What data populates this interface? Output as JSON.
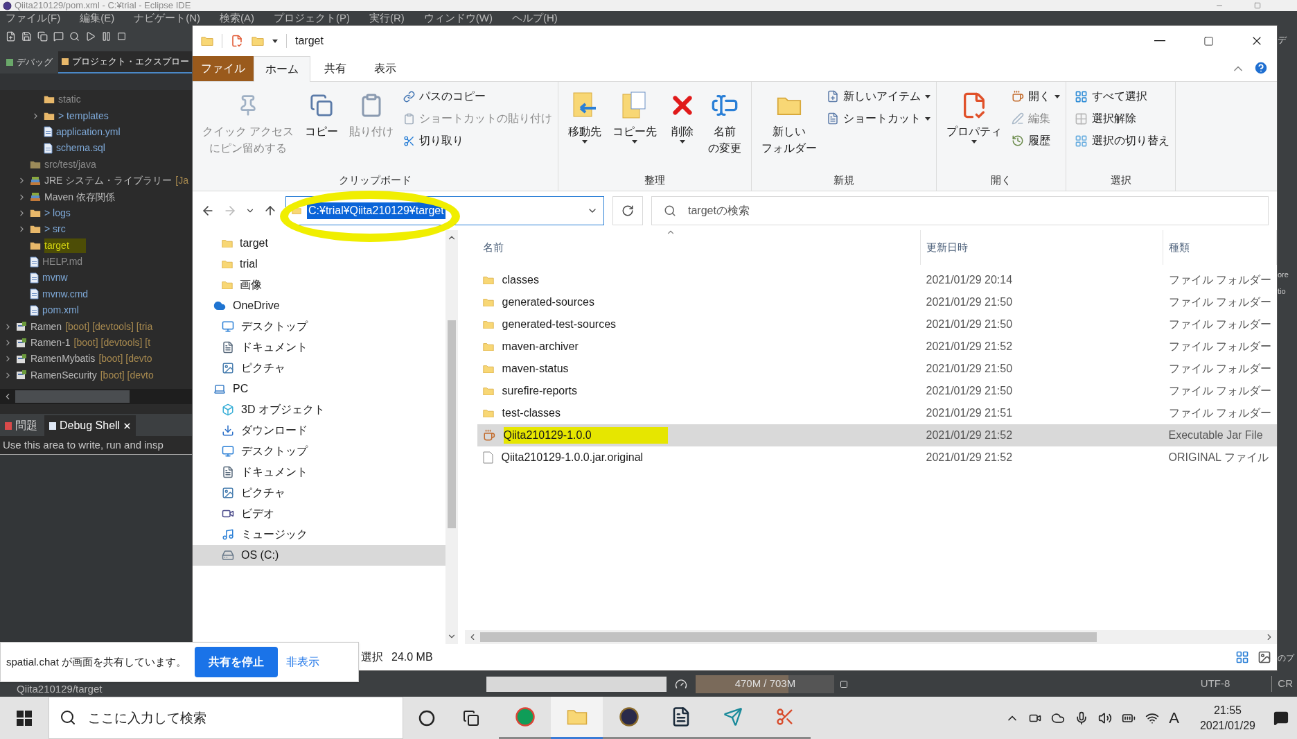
{
  "eclipse": {
    "title": "Qiita210129/pom.xml - C:¥trial - Eclipse IDE",
    "menu": [
      "ファイル(F)",
      "編集(E)",
      "ナビゲート(N)",
      "検索(A)",
      "プロジェクト(P)",
      "実行(R)",
      "ウィンドウ(W)",
      "ヘルプ(H)"
    ],
    "view_tabs": [
      {
        "label": "デバッグ",
        "selected": false
      },
      {
        "label": "プロジェクト・エクスプロー",
        "selected": true
      }
    ],
    "tree": [
      {
        "children": [
          {
            "children": [
              {
                "label": "static",
                "kind": "ignored-folder",
                "expandable": false,
                "highlighted": false
              },
              {
                "label": "> templates",
                "kind": "folder",
                "expandable": true,
                "highlighted": false
              },
              {
                "label": "application.yml",
                "kind": "file",
                "expandable": false,
                "highlighted": false
              },
              {
                "label": "schema.sql",
                "kind": "file",
                "expandable": false,
                "highlighted": false
              }
            ]
          },
          {
            "label": "src/test/java",
            "kind": "source-folder",
            "expandable": false,
            "highlighted": false
          },
          {
            "label": "JRE システム・ライブラリー",
            "note": "[Ja",
            "kind": "library",
            "expandable": true,
            "highlighted": false
          },
          {
            "label": "Maven 依存関係",
            "kind": "library",
            "expandable": true,
            "highlighted": false
          },
          {
            "label": "> logs",
            "kind": "folder",
            "expandable": true,
            "highlighted": false
          },
          {
            "label": "> src",
            "kind": "folder",
            "expandable": true,
            "highlighted": false
          },
          {
            "label": "target",
            "kind": "folder",
            "expandable": false,
            "highlighted": true
          },
          {
            "label": "HELP.md",
            "kind": "ignored-file",
            "expandable": false,
            "highlighted": false
          },
          {
            "label": "mvnw",
            "kind": "file",
            "expandable": false,
            "highlighted": false
          },
          {
            "label": "mvnw.cmd",
            "kind": "file",
            "expandable": false,
            "highlighted": false
          },
          {
            "label": "pom.xml",
            "kind": "file",
            "expandable": false,
            "highlighted": false
          }
        ]
      },
      {
        "label": "Ramen",
        "note": "[boot] [devtools] [tria",
        "kind": "project",
        "expandable": true,
        "highlighted": false
      },
      {
        "label": "Ramen-1",
        "note": "[boot] [devtools] [t",
        "kind": "project",
        "expandable": true,
        "highlighted": false
      },
      {
        "label": "RamenMybatis",
        "note": "[boot] [devto",
        "kind": "project",
        "expandable": true,
        "highlighted": false
      },
      {
        "label": "RamenSecurity",
        "note": "[boot] [devto",
        "kind": "project",
        "expandable": true,
        "highlighted": false
      }
    ],
    "bottom_tabs": [
      {
        "label": "問題",
        "selected": false,
        "closable": false
      },
      {
        "label": "Debug Shell",
        "selected": true,
        "closable": true
      }
    ],
    "shell_hint": "Use this area to write, run and insp",
    "status": {
      "path": "Qiita210129/target",
      "memory": "470M / 703M",
      "level": 0.67,
      "encoding": "UTF-8",
      "line_end": "CR"
    },
    "edge_texts": [
      "デ",
      "ore",
      "tio",
      "のプ"
    ]
  },
  "explorer": {
    "title": "target",
    "tabs": [
      {
        "label": "ファイル",
        "kind": "file-menu",
        "selected": false
      },
      {
        "label": "ホーム",
        "kind": "tab",
        "selected": true
      },
      {
        "label": "共有",
        "kind": "tab",
        "selected": false
      },
      {
        "label": "表示",
        "kind": "tab",
        "selected": false
      }
    ],
    "ribbon": [
      {
        "label": "クリップボード",
        "items": [
          {
            "kind": "large",
            "lines": [
              "クイック アクセス",
              "にピン留めする"
            ],
            "disabled": true,
            "dropdown": false
          },
          {
            "kind": "large",
            "lines": [
              "コピー"
            ],
            "disabled": false,
            "dropdown": false
          },
          {
            "kind": "large",
            "lines": [
              "貼り付け"
            ],
            "disabled": true,
            "dropdown": false
          },
          {
            "kind": "small",
            "lines": [
              "パスのコピー"
            ],
            "disabled": false,
            "dropdown": false
          },
          {
            "kind": "small",
            "lines": [
              "ショートカットの貼り付け"
            ],
            "disabled": true,
            "dropdown": false
          },
          {
            "kind": "small",
            "lines": [
              "切り取り"
            ],
            "disabled": false,
            "dropdown": false
          }
        ]
      },
      {
        "label": "整理",
        "items": [
          {
            "kind": "large",
            "lines": [
              "移動先"
            ],
            "disabled": false,
            "dropdown": true
          },
          {
            "kind": "large",
            "lines": [
              "コピー先"
            ],
            "disabled": false,
            "dropdown": true
          },
          {
            "kind": "large",
            "lines": [
              "削除"
            ],
            "disabled": false,
            "dropdown": true
          },
          {
            "kind": "large",
            "lines": [
              "名前",
              "の変更"
            ],
            "disabled": false,
            "dropdown": false
          }
        ]
      },
      {
        "label": "新規",
        "items": [
          {
            "kind": "large",
            "lines": [
              "新しい",
              "フォルダー"
            ],
            "disabled": false,
            "dropdown": false
          },
          {
            "kind": "small",
            "lines": [
              "新しいアイテム"
            ],
            "disabled": false,
            "dropdown": true
          },
          {
            "kind": "small",
            "lines": [
              "ショートカット"
            ],
            "disabled": false,
            "dropdown": true
          }
        ]
      },
      {
        "label": "開く",
        "items": [
          {
            "kind": "large",
            "lines": [
              "プロパティ"
            ],
            "disabled": false,
            "dropdown": true
          },
          {
            "kind": "small",
            "lines": [
              "開く"
            ],
            "disabled": false,
            "dropdown": true
          },
          {
            "kind": "small",
            "lines": [
              "編集"
            ],
            "disabled": true,
            "dropdown": false
          },
          {
            "kind": "small",
            "lines": [
              "履歴"
            ],
            "disabled": false,
            "dropdown": false
          }
        ]
      },
      {
        "label": "選択",
        "items": [
          {
            "kind": "small",
            "lines": [
              "すべて選択"
            ],
            "disabled": false,
            "dropdown": false
          },
          {
            "kind": "small",
            "lines": [
              "選択解除"
            ],
            "disabled": false,
            "dropdown": false
          },
          {
            "kind": "small",
            "lines": [
              "選択の切り替え"
            ],
            "disabled": false,
            "dropdown": false
          }
        ]
      }
    ],
    "address": {
      "value": "C:¥trial¥Qiita210129¥target",
      "circled": true
    },
    "search": {
      "placeholder": "targetの検索"
    },
    "nav": [
      {
        "children": [
          {
            "label": "target",
            "kind": "folder",
            "selected": false
          },
          {
            "label": "trial",
            "kind": "folder",
            "selected": false
          },
          {
            "label": "画像",
            "kind": "folder",
            "selected": false
          }
        ]
      },
      {
        "label": "OneDrive",
        "kind": "cloud",
        "selected": false,
        "children": [
          {
            "label": "デスクトップ",
            "kind": "desktop",
            "selected": false
          },
          {
            "label": "ドキュメント",
            "kind": "document",
            "selected": false
          },
          {
            "label": "ピクチャ",
            "kind": "picture",
            "selected": false
          }
        ]
      },
      {
        "label": "PC",
        "kind": "pc",
        "selected": false,
        "children": [
          {
            "label": "3D オブジェクト",
            "kind": "cube",
            "selected": false
          },
          {
            "label": "ダウンロード",
            "kind": "download",
            "selected": false
          },
          {
            "label": "デスクトップ",
            "kind": "desktop",
            "selected": false
          },
          {
            "label": "ドキュメント",
            "kind": "document",
            "selected": false
          },
          {
            "label": "ピクチャ",
            "kind": "picture",
            "selected": false
          },
          {
            "label": "ビデオ",
            "kind": "video",
            "selected": false
          },
          {
            "label": "ミュージック",
            "kind": "music",
            "selected": false
          },
          {
            "label": "OS (C:)",
            "kind": "drive",
            "selected": true
          }
        ]
      }
    ],
    "columns": [
      "名前",
      "更新日時",
      "種類"
    ],
    "rows": [
      {
        "name": "classes",
        "date": "2021/01/29 20:14",
        "type": "ファイル フォルダー",
        "kind": "folder",
        "selected": false,
        "highlighted": false
      },
      {
        "name": "generated-sources",
        "date": "2021/01/29 21:50",
        "type": "ファイル フォルダー",
        "kind": "folder",
        "selected": false,
        "highlighted": false
      },
      {
        "name": "generated-test-sources",
        "date": "2021/01/29 21:50",
        "type": "ファイル フォルダー",
        "kind": "folder",
        "selected": false,
        "highlighted": false
      },
      {
        "name": "maven-archiver",
        "date": "2021/01/29 21:52",
        "type": "ファイル フォルダー",
        "kind": "folder",
        "selected": false,
        "highlighted": false
      },
      {
        "name": "maven-status",
        "date": "2021/01/29 21:50",
        "type": "ファイル フォルダー",
        "kind": "folder",
        "selected": false,
        "highlighted": false
      },
      {
        "name": "surefire-reports",
        "date": "2021/01/29 21:50",
        "type": "ファイル フォルダー",
        "kind": "folder",
        "selected": false,
        "highlighted": false
      },
      {
        "name": "test-classes",
        "date": "2021/01/29 21:51",
        "type": "ファイル フォルダー",
        "kind": "folder",
        "selected": false,
        "highlighted": false
      },
      {
        "name": "Qiita210129-1.0.0",
        "date": "2021/01/29 21:52",
        "type": "Executable Jar File",
        "kind": "jar",
        "selected": true,
        "highlighted": true
      },
      {
        "name": "Qiita210129-1.0.0.jar.original",
        "date": "2021/01/29 21:52",
        "type": "ORIGINAL ファイル",
        "kind": "file",
        "selected": false,
        "highlighted": false
      }
    ],
    "status": {
      "selection": "選択",
      "size": "24.0 MB"
    }
  },
  "share_popup": {
    "message": "spatial.chat が画面を共有しています。",
    "stop": "共有を停止",
    "hide": "非表示"
  },
  "taskbar": {
    "search_placeholder": "ここに入力して検索",
    "ime": "A",
    "time": "21:55",
    "date": "2021/01/29"
  }
}
